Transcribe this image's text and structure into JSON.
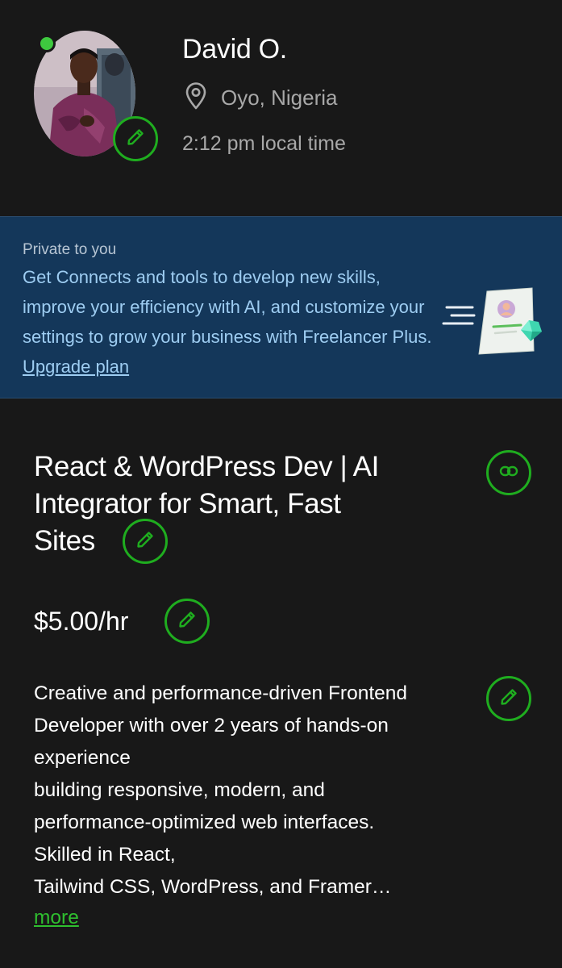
{
  "profile": {
    "name": "David O.",
    "location": "Oyo, Nigeria",
    "local_time": "2:12 pm local time",
    "status": "online"
  },
  "promo": {
    "label": "Private to you",
    "text": "Get Connects and tools to develop new skills, improve your efficiency with AI, and customize your settings to grow your business with Freelancer Plus.",
    "link_label": "Upgrade plan"
  },
  "title": {
    "lines": [
      "React & WordPress Dev | AI",
      "Integrator for Smart, Fast",
      "Sites"
    ]
  },
  "rate": "$5.00/hr",
  "overview": {
    "lines": [
      "Creative and performance-driven Frontend",
      "Developer with over 2 years of hands-on",
      "experience",
      "building responsive, modern, and",
      "performance-optimized web interfaces.",
      "Skilled in React,",
      "Tailwind CSS, WordPress, and Framer…"
    ],
    "more_label": "more"
  },
  "colors": {
    "background": "#181818",
    "accent_green": "#1fad1f",
    "online_green": "#3ec93f",
    "promo_bg": "#14375a",
    "promo_text": "#9ecdf2",
    "muted_text": "#a8a8a8"
  },
  "icons": {
    "avatar_edit": "pencil-icon",
    "location": "map-pin-icon",
    "title_edit": "pencil-icon",
    "share": "link-icon",
    "rate_edit": "pencil-icon",
    "overview_edit": "pencil-icon"
  }
}
